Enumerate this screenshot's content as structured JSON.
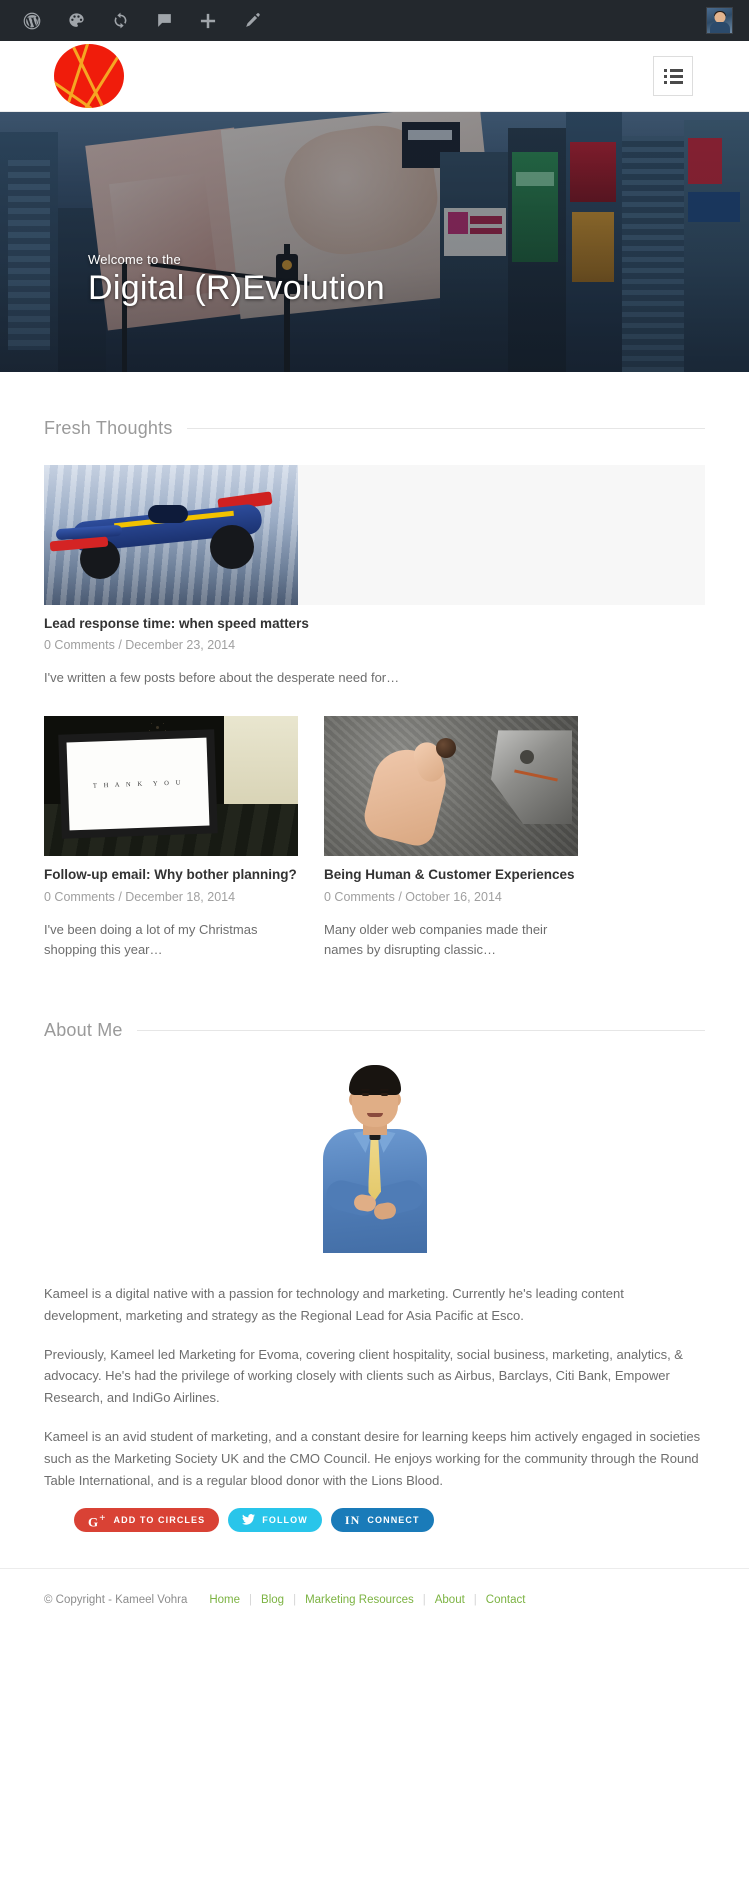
{
  "adminbar": {
    "items": [
      {
        "icon": "wordpress-icon",
        "label": "WordPress"
      },
      {
        "icon": "palette-icon",
        "label": "Customize"
      },
      {
        "icon": "updates-icon",
        "label": "Updates"
      },
      {
        "icon": "comment-icon",
        "label": "Comments"
      },
      {
        "icon": "plus-icon",
        "label": "New"
      },
      {
        "icon": "pencil-icon",
        "label": "Edit"
      }
    ],
    "avatar_label": "Howdy, Kameel"
  },
  "header": {
    "logo_label": "Kameel Vohra",
    "menu_toggle_label": "Menu"
  },
  "hero": {
    "subtitle": "Welcome to the",
    "title": "Digital (R)Evolution"
  },
  "sections": {
    "fresh_thoughts": "Fresh Thoughts",
    "about_me": "About Me"
  },
  "posts": [
    {
      "title": "Lead response time: when speed matters",
      "comments": "0 Comments",
      "date": "December 23, 2014",
      "meta": "0 Comments / December 23, 2014",
      "excerpt": "I've written a few posts before about the desperate need for…",
      "image": "formula-one-race-car"
    },
    {
      "title": "Follow-up email: Why bother planning?",
      "comments": "0 Comments",
      "date": "December 18, 2014",
      "meta": "0 Comments / December 18, 2014",
      "excerpt": "I've been doing a lot of my Christmas shopping this year…",
      "image": "thank-you-card"
    },
    {
      "title": "Being Human & Customer Experiences",
      "comments": "0 Comments",
      "date": "October 16, 2014",
      "meta": "0 Comments / October 16, 2014",
      "excerpt": "Many older web companies made their names by disrupting classic…",
      "image": "human-hand-and-robot-hand"
    }
  ],
  "about": {
    "portrait_label": "Kameel Vohra portrait",
    "paragraphs": [
      "Kameel is a digital native with a passion for technology and marketing. Currently he's leading content development, marketing and strategy as the Regional Lead for Asia Pacific at Esco.",
      "Previously, Kameel led Marketing for Evoma, covering client hospitality, social business, marketing, analytics, & advocacy. He's had the privilege of working closely with clients such as Airbus, Barclays, Citi Bank, Empower Research, and IndiGo Airlines.",
      "Kameel is an avid student of marketing, and a constant desire for learning keeps him actively engaged in societies such as the Marketing Society UK and the CMO Council. He enjoys working for the community through the Round Table International, and is a regular blood donor with the Lions Blood."
    ]
  },
  "socials": [
    {
      "network": "google-plus",
      "icon": "google-plus-icon",
      "glyph": "g+",
      "label": "Add to Circles",
      "color": "#d94235"
    },
    {
      "network": "twitter",
      "icon": "twitter-icon",
      "glyph": "bird",
      "label": "Follow",
      "color": "#29c5ea"
    },
    {
      "network": "linkedin",
      "icon": "linkedin-icon",
      "glyph": "in",
      "label": "Connect",
      "color": "#1a7bb9"
    }
  ],
  "footer": {
    "copyright": "© Copyright - Kameel Vohra",
    "links": [
      "Home",
      "Blog",
      "Marketing Resources",
      "About",
      "Contact"
    ],
    "link_color": "#7cb342"
  }
}
